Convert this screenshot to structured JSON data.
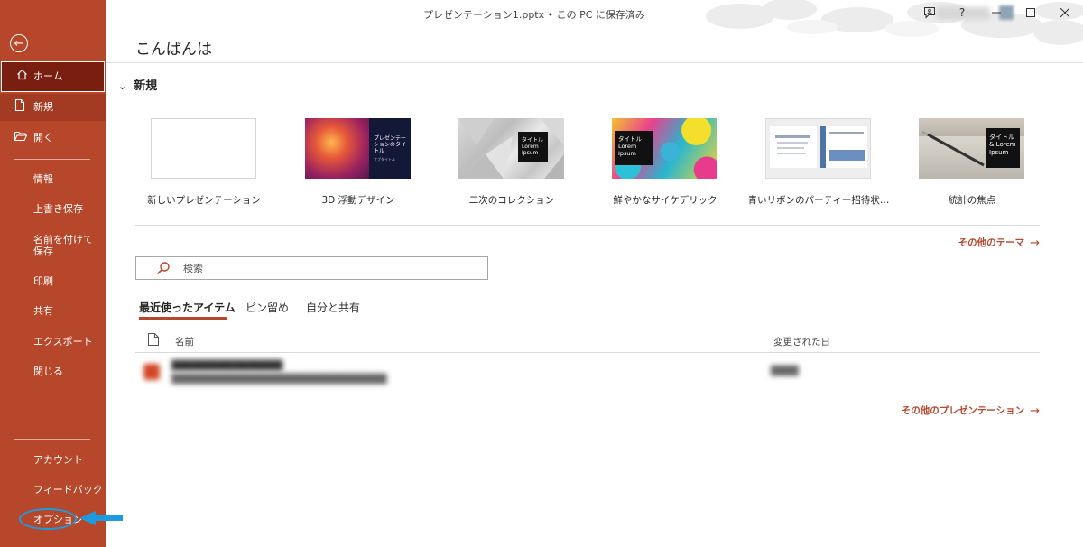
{
  "window": {
    "title": "プレゼンテーション1.pptx • この PC に保存済み",
    "controls": {
      "help": "?"
    }
  },
  "sidebar": {
    "items": {
      "home": "ホーム",
      "new": "新規",
      "open": "開く",
      "info": "情報",
      "save": "上書き保存",
      "saveas": "名前を付けて保存",
      "print": "印刷",
      "share": "共有",
      "export": "エクスポート",
      "close": "閉じる",
      "account": "アカウント",
      "feedback": "フィードバック",
      "options": "オプション"
    },
    "colors": {
      "background": "#b7472a",
      "selected": "#7a1e0f",
      "highlight_annotation": "#1d9be0"
    }
  },
  "main": {
    "greeting": "こんばんは",
    "new_section": {
      "heading": "新規",
      "templates": [
        {
          "label": "新しいプレゼンテーション"
        },
        {
          "label": "3D 浮動デザイン",
          "thumb_title": "プレゼンテーションのタイトル",
          "thumb_sub": "サブタイトル"
        },
        {
          "label": "二次のコレクション",
          "thumb_title": "タイトル Lorem Ipsum"
        },
        {
          "label": "鮮やかなサイケデリック",
          "thumb_title": "タイトル Lorem Ipsum"
        },
        {
          "label": "青いリボンのパーティー招待状…"
        },
        {
          "label": "統計の焦点",
          "thumb_title": "タイトル & Lorem Ipsum"
        }
      ],
      "more_themes": "その他のテーマ"
    },
    "search": {
      "placeholder": "検索"
    },
    "tabs": {
      "recent": "最近使ったアイテム",
      "pinned": "ピン留め",
      "shared": "自分と共有"
    },
    "table": {
      "col_name": "名前",
      "col_modified": "変更された日"
    },
    "more_presentations": "その他のプレゼンテーション"
  }
}
